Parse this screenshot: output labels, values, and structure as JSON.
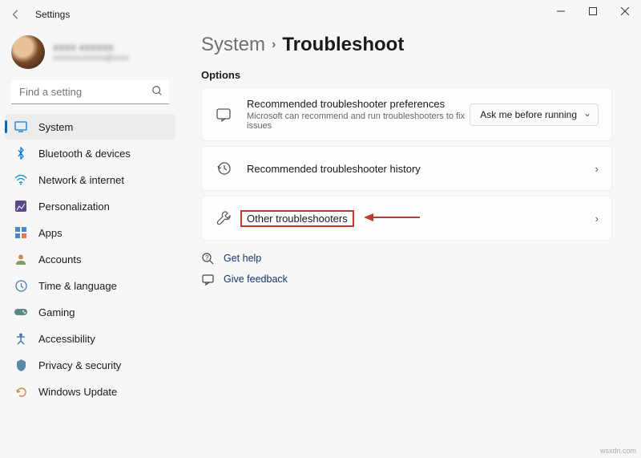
{
  "window": {
    "title": "Settings"
  },
  "user": {
    "name": "xxxx xxxxxx",
    "email": "xxxxxxxxxxxxx@xxxx"
  },
  "search": {
    "placeholder": "Find a setting"
  },
  "nav": [
    {
      "key": "system",
      "label": "System",
      "active": true
    },
    {
      "key": "bluetooth",
      "label": "Bluetooth & devices"
    },
    {
      "key": "network",
      "label": "Network & internet"
    },
    {
      "key": "personalization",
      "label": "Personalization"
    },
    {
      "key": "apps",
      "label": "Apps"
    },
    {
      "key": "accounts",
      "label": "Accounts"
    },
    {
      "key": "time",
      "label": "Time & language"
    },
    {
      "key": "gaming",
      "label": "Gaming"
    },
    {
      "key": "accessibility",
      "label": "Accessibility"
    },
    {
      "key": "privacy",
      "label": "Privacy & security"
    },
    {
      "key": "update",
      "label": "Windows Update"
    }
  ],
  "breadcrumb": {
    "parent": "System",
    "current": "Troubleshoot"
  },
  "section": "Options",
  "cards": {
    "recommended": {
      "title": "Recommended troubleshooter preferences",
      "subtitle": "Microsoft can recommend and run troubleshooters to fix issues",
      "dropdown": "Ask me before running"
    },
    "history": {
      "title": "Recommended troubleshooter history"
    },
    "other": {
      "title": "Other troubleshooters"
    }
  },
  "links": {
    "help": "Get help",
    "feedback": "Give feedback"
  },
  "watermark": "wsxdn.com"
}
